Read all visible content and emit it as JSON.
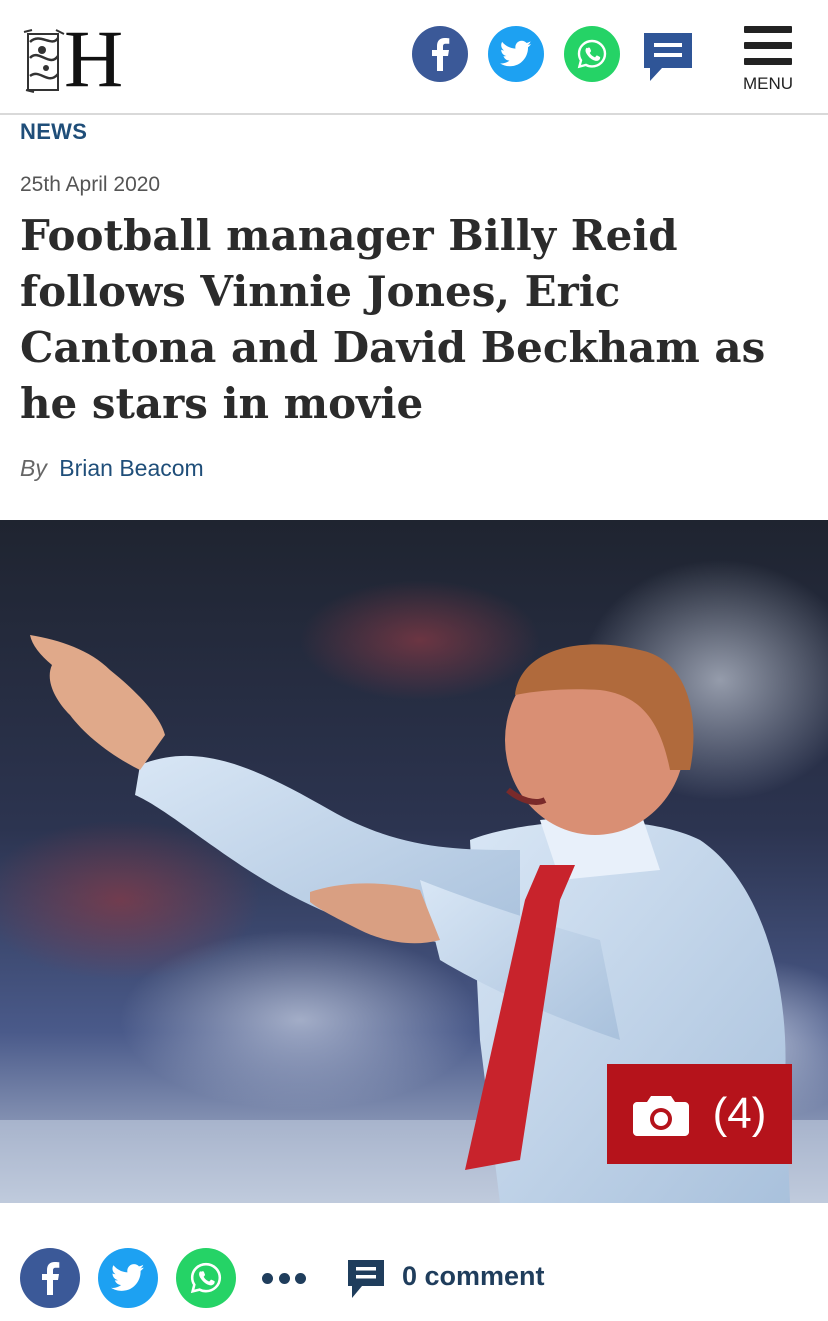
{
  "header": {
    "logo_letter": "H",
    "share": {
      "facebook_icon": "facebook-icon",
      "twitter_icon": "twitter-icon",
      "whatsapp_icon": "whatsapp-icon",
      "comments_icon": "comment-icon"
    },
    "menu_label": "MENU"
  },
  "article": {
    "section": "NEWS",
    "date": "25th April 2020",
    "headline": "Football manager Billy Reid follows Vinnie Jones, Eric Cantona and David Beckham as he stars in movie",
    "byline_prefix": "By",
    "author": "Brian Beacom"
  },
  "hero": {
    "gallery_icon": "camera-icon",
    "gallery_count": "(4)"
  },
  "footer_share": {
    "facebook_icon": "facebook-icon",
    "twitter_icon": "twitter-icon",
    "whatsapp_icon": "whatsapp-icon",
    "more_icon": "more-dots-icon",
    "comment_icon": "comment-icon",
    "comment_count": "0 comment"
  },
  "colors": {
    "facebook": "#3b5998",
    "twitter": "#1da1f2",
    "whatsapp": "#25d366",
    "accent_navy": "#1f4e79",
    "gallery_badge": "#b5131b"
  }
}
